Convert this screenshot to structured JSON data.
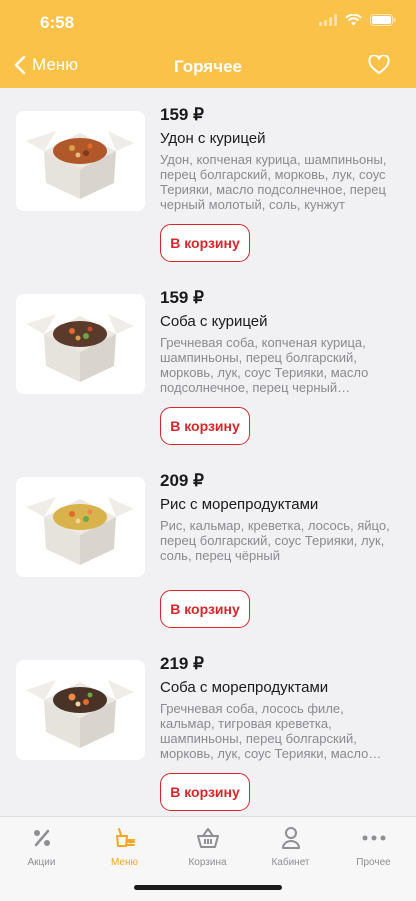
{
  "status": {
    "time": "6:58"
  },
  "nav": {
    "back_label": "Меню",
    "title": "Горячее"
  },
  "products": [
    {
      "price": "159 ₽",
      "name": "Удон с курицей",
      "description": "Удон, копченая курица, шампиньоны, перец болгарский, морковь, лук, соус Терияки, масло подсолнечное, перец черный молотый, соль, кунжут",
      "button": "В корзину"
    },
    {
      "price": "159 ₽",
      "name": "Соба с курицей",
      "description": "Гречневая соба, копченая курица, шампиньоны, перец болгарский, морковь, лук, соус Терияки, масло подсолнечное, перец черный молотый...",
      "button": "В корзину"
    },
    {
      "price": "209 ₽",
      "name": "Рис с морепродуктами",
      "description": "Рис, кальмар, креветка, лосось, яйцо, перец болгарский, соус Терияки, лук, соль, перец чёрный",
      "button": "В корзину"
    },
    {
      "price": "219 ₽",
      "name": "Соба с морепродуктами",
      "description": "Гречневая соба, лосось филе, кальмар, тигровая креветка, шампиньоны, перец болгарский, морковь, лук, соус Терияки, масло подсолнечное, соль,...",
      "button": "В корзину"
    }
  ],
  "tabs": [
    {
      "label": "Акции",
      "icon": "percent-icon"
    },
    {
      "label": "Меню",
      "icon": "menu-food-icon",
      "active": true
    },
    {
      "label": "Корзина",
      "icon": "basket-icon"
    },
    {
      "label": "Кабинет",
      "icon": "person-icon"
    },
    {
      "label": "Прочее",
      "icon": "more-icon"
    }
  ],
  "colors": {
    "accent": "#fbc24a",
    "button": "#d8262c",
    "active_tab": "#f5a623"
  }
}
